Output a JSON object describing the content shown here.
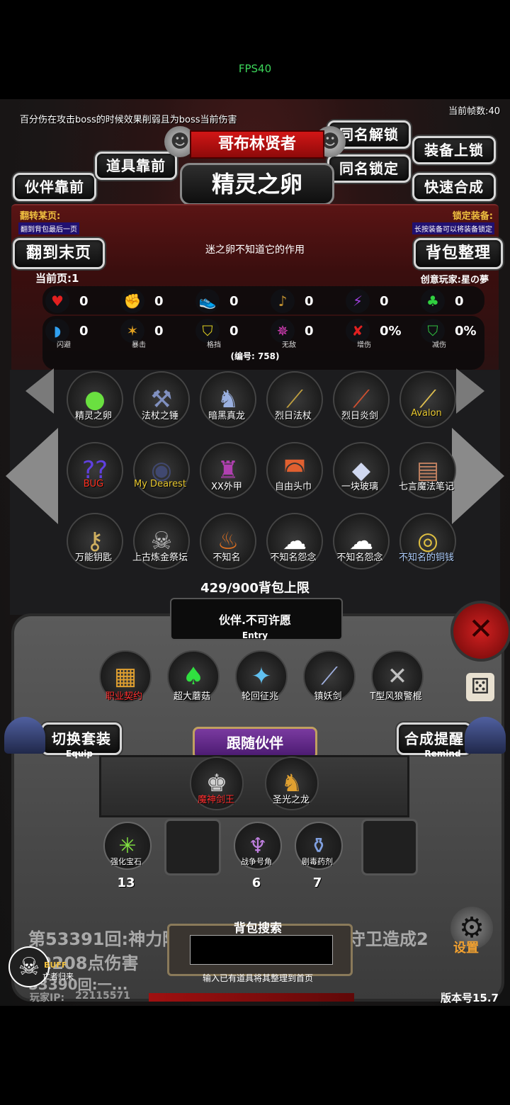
{
  "system": {
    "fps": "FPS40"
  },
  "hud": {
    "note": "百分伤在攻击boss的时候效果削弱且为boss当前伤害",
    "frame_rate": "当前帧数:40",
    "version": "版本号15.7",
    "player_ip_label": "玩家IP:",
    "player_ip": "22115571",
    "buff_label": "BUFF",
    "buff_sub": "亡者归来",
    "settings": "设置"
  },
  "header": {
    "subtitle": "哥布林贤者",
    "title": "精灵之卵",
    "buttons": {
      "companion_front": "伙伴靠前",
      "item_front": "道具靠前",
      "same_unlock": "同名解锁",
      "same_lock": "同名锁定",
      "equip_up": "装备上锁",
      "quick_merge": "快速合成"
    }
  },
  "info": {
    "flip_label": "翻转某页:",
    "flip_desc": "翻到背包最后一页",
    "lock_label": "锁定装备:",
    "lock_desc": "长按装备可以将装备锁定",
    "to_last": "翻到末页",
    "sort": "背包整理",
    "description": "迷之卵不知道它的作用",
    "current_page": "当前页:1",
    "creator": "创意玩家:星の夢",
    "serial": "(编号: 758)"
  },
  "stats": [
    {
      "icon": "heart-icon",
      "glyph": "♥",
      "color": "#e02020",
      "value": "0",
      "label": ""
    },
    {
      "icon": "strength-icon",
      "glyph": "✊",
      "color": "#e8c020",
      "value": "0",
      "label": ""
    },
    {
      "icon": "shoe-icon",
      "glyph": "👟",
      "color": "#3090e0",
      "value": "0",
      "label": ""
    },
    {
      "icon": "lyre-icon",
      "glyph": "♪",
      "color": "#c09030",
      "value": "0",
      "label": ""
    },
    {
      "icon": "lightning-icon",
      "glyph": "⚡",
      "color": "#a040e0",
      "value": "0",
      "label": ""
    },
    {
      "icon": "clover-icon",
      "glyph": "♣",
      "color": "#30d040",
      "value": "0",
      "label": ""
    },
    {
      "icon": "dodge-icon",
      "glyph": "◗",
      "color": "#30a0f0",
      "value": "0",
      "label": "闪避"
    },
    {
      "icon": "crit-icon",
      "glyph": "✶",
      "color": "#e0a020",
      "value": "0",
      "label": "暴击"
    },
    {
      "icon": "block-icon",
      "glyph": "⛉",
      "color": "#e0d020",
      "value": "0",
      "label": "格挡"
    },
    {
      "icon": "invincible-icon",
      "glyph": "✵",
      "color": "#e040c0",
      "value": "0",
      "label": "无敌"
    },
    {
      "icon": "damage-up-icon",
      "glyph": "✘",
      "color": "#e02020",
      "value": "0%",
      "label": "增伤"
    },
    {
      "icon": "damage-reduce-icon",
      "glyph": "⛉",
      "color": "#30c040",
      "value": "0%",
      "label": "减伤"
    }
  ],
  "inventory": [
    {
      "name": "精灵之卵",
      "icon": "slime-egg-icon",
      "glyph": "●",
      "color": "#6ae040",
      "label_color": "#ffffff"
    },
    {
      "name": "法杖之锤",
      "icon": "staff-hammer-icon",
      "glyph": "⚒",
      "color": "#8090c0",
      "label_color": "#ffffff"
    },
    {
      "name": "暗黑真龙",
      "icon": "dark-dragon-icon",
      "glyph": "♞",
      "color": "#9ab0e0",
      "label_color": "#ffffff"
    },
    {
      "name": "烈日法杖",
      "icon": "sun-staff-icon",
      "glyph": "⟋",
      "color": "#c0a040",
      "label_color": "#ffffff"
    },
    {
      "name": "烈日炎剑",
      "icon": "flame-sword-icon",
      "glyph": "⟋",
      "color": "#d05030",
      "label_color": "#ffffff"
    },
    {
      "name": "Avalon",
      "icon": "avalon-sword-icon",
      "glyph": "⟋",
      "color": "#e0c050",
      "label_color": "#e8c830"
    },
    {
      "name": "BUG",
      "icon": "bug-icon",
      "glyph": "??",
      "color": "#6040e0",
      "label_color": "#ff3020"
    },
    {
      "name": "My Dearest",
      "icon": "dark-orb-icon",
      "glyph": "◉",
      "color": "#404870",
      "label_color": "#e8c830"
    },
    {
      "name": "XX外甲",
      "icon": "armor-icon",
      "glyph": "♜",
      "color": "#b040b0",
      "label_color": "#ffffff"
    },
    {
      "name": "自由头巾",
      "icon": "headscarf-icon",
      "glyph": "◚",
      "color": "#e06030",
      "label_color": "#ffffff"
    },
    {
      "name": "一块玻璃",
      "icon": "glass-icon",
      "glyph": "◆",
      "color": "#d0d8f0",
      "label_color": "#ffffff"
    },
    {
      "name": "七言魔法笔记",
      "icon": "magic-book-icon",
      "glyph": "▤",
      "color": "#c08060",
      "label_color": "#ffffff"
    },
    {
      "name": "万能钥匙",
      "icon": "key-icon",
      "glyph": "⚷",
      "color": "#d0b060",
      "label_color": "#ffffff"
    },
    {
      "name": "上古炼金祭坛",
      "icon": "skull-altar-icon",
      "glyph": "☠",
      "color": "#c0c0c0",
      "label_color": "#ffffff"
    },
    {
      "name": "不知名",
      "icon": "flame-spirit-icon",
      "glyph": "♨",
      "color": "#e07020",
      "label_color": "#ffffff"
    },
    {
      "name": "不知名怨念",
      "icon": "ghost-icon",
      "glyph": "☁",
      "color": "#ffffff",
      "label_color": "#ffffff"
    },
    {
      "name": "不知名怨念",
      "icon": "ghost-icon",
      "glyph": "☁",
      "color": "#ffffff",
      "label_color": "#ffffff"
    },
    {
      "name": "不知名的铜钱",
      "icon": "coin-icon",
      "glyph": "◎",
      "color": "#e0c040",
      "label_color": "#b0d0ff"
    }
  ],
  "capacity": "429/900背包上限",
  "companion": {
    "title": "伙伴.不可许愿",
    "entry": "Entry",
    "items": [
      {
        "name": "职业契约",
        "icon": "scroll-icon",
        "glyph": "▦",
        "color": "#e0a030",
        "label_color": "#ff3030"
      },
      {
        "name": "超大蘑菇",
        "icon": "mushroom-icon",
        "glyph": "♠",
        "color": "#30e040",
        "label_color": "#ffffff"
      },
      {
        "name": "轮回征兆",
        "icon": "cycle-staff-icon",
        "glyph": "✦",
        "color": "#60c0f0",
        "label_color": "#ffffff"
      },
      {
        "name": "镇妖剑",
        "icon": "demon-sword-icon",
        "glyph": "⟋",
        "color": "#a0b0e0",
        "label_color": "#ffffff"
      },
      {
        "name": "T型风狼警棍",
        "icon": "baton-icon",
        "glyph": "✕",
        "color": "#c0c0c0",
        "label_color": "#ffffff"
      }
    ],
    "switch_equip": "切换套装",
    "switch_equip_sub": "Equip",
    "merge_remind": "合成提醒",
    "merge_remind_sub": "Remind",
    "follow_title": "跟随伙伴",
    "followers": [
      {
        "name": "魔神剑王",
        "icon": "sword-king-icon",
        "glyph": "♚",
        "color": "#d0d0d0",
        "label_color": "#ff3030"
      },
      {
        "name": "圣光之龙",
        "icon": "holy-dragon-icon",
        "glyph": "♞",
        "color": "#e0a030",
        "label_color": "#ffffff"
      }
    ],
    "consumables": [
      {
        "name": "强化宝石",
        "icon": "gem-icon",
        "glyph": "✳",
        "color": "#80e040",
        "count": "13"
      },
      {
        "name": "",
        "icon": "",
        "glyph": "",
        "color": "",
        "count": ""
      },
      {
        "name": "战争号角",
        "icon": "horn-icon",
        "glyph": "♆",
        "color": "#c080e0",
        "count": "6"
      },
      {
        "name": "剧毒药剂",
        "icon": "potion-icon",
        "glyph": "⚱",
        "color": "#80a0e0",
        "count": "7"
      },
      {
        "name": "",
        "icon": "",
        "glyph": "",
        "color": "",
        "count": ""
      }
    ]
  },
  "search": {
    "title": "背包搜索",
    "hint": "输入已有道具将其整理到首页",
    "value": ""
  },
  "log": {
    "line1_a": "第53391回:神力附",
    "line1_b": "守卫造成2",
    "line2": "02208点伤害",
    "line3": "53390回:一..."
  }
}
